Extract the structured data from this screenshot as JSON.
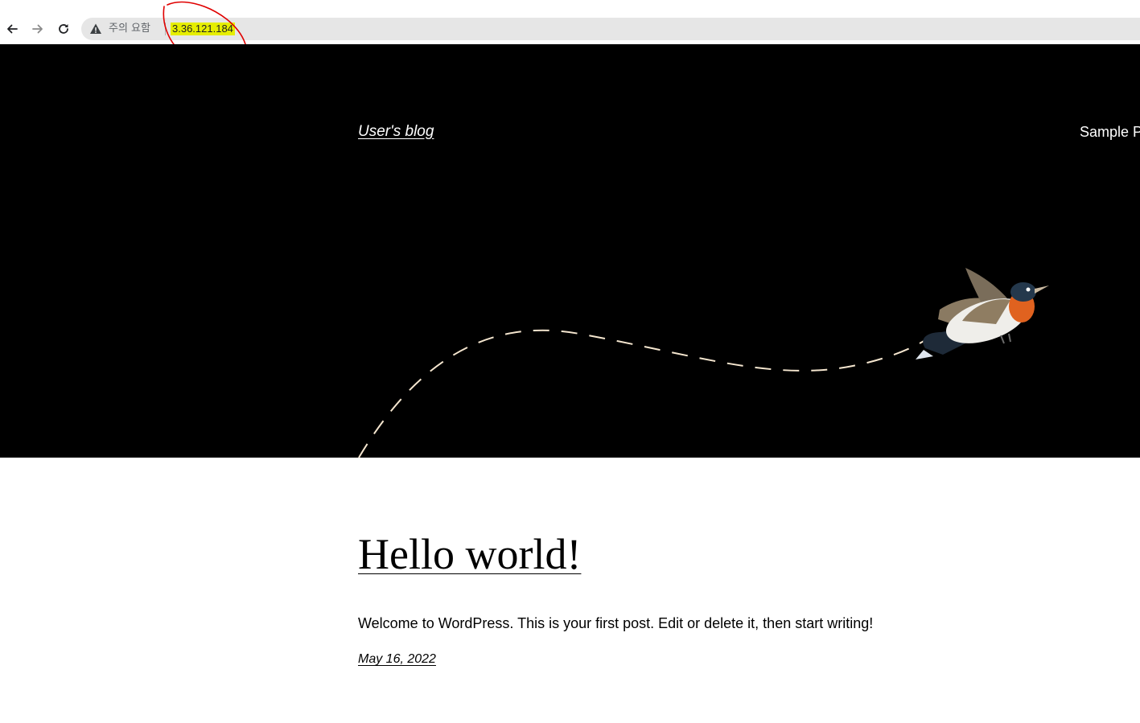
{
  "browser": {
    "security_label": "주의 요함",
    "url": "3.36.121.184",
    "icons": [
      "back-arrow-icon",
      "forward-arrow-icon",
      "reload-icon",
      "warning-icon"
    ],
    "highlight_color": "#e6ee00",
    "annotation_color": "#e00000"
  },
  "site": {
    "title": "User's blog",
    "nav_item": "Sample Pa"
  },
  "post": {
    "title": "Hello world!",
    "excerpt": "Welcome to WordPress. This is your first post. Edit or delete it, then start writing!",
    "date": "May 16, 2022"
  },
  "colors": {
    "hero_background": "#000000",
    "flight_path": "#f5e6cf"
  }
}
